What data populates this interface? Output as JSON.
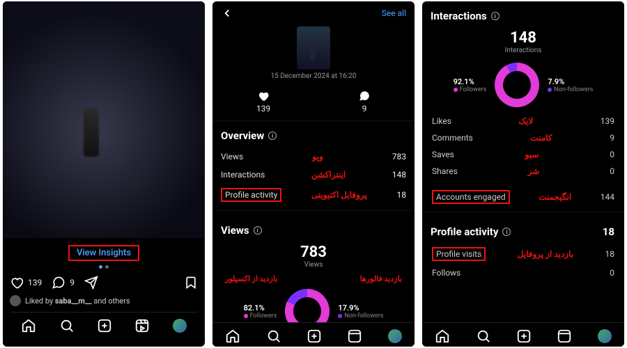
{
  "panel1": {
    "view_insights": "View Insights",
    "likes": "139",
    "comments": "9",
    "liked_by_prefix": "Liked by",
    "liked_by_user": "saba__m__",
    "liked_by_suffix": "and others"
  },
  "panel2": {
    "see_all": "See all",
    "timestamp": "15 December 2024 at 16:20",
    "likes": "139",
    "comments": "9",
    "overview_title": "Overview",
    "rows": {
      "views": {
        "label": "Views",
        "anno": "ویو",
        "value": "783"
      },
      "interactions": {
        "label": "Interactions",
        "anno": "اینتراکشن",
        "value": "148"
      },
      "profile": {
        "label": "Profile activity",
        "anno": "پروفایل اکتیویتی",
        "value": "18"
      }
    },
    "views_title": "Views",
    "views_total": "783",
    "views_sub": "Views",
    "followers_pct": "82.1%",
    "followers_lab": "Followers",
    "non_followers_pct": "17.9%",
    "non_followers_lab": "Non-followers",
    "anno_followers": "بازدید فالورها",
    "anno_explore": "بازدید از اکسپلور",
    "colors": {
      "followers": "#e23bd8",
      "nonfollowers": "#7b2fff"
    }
  },
  "panel3": {
    "interactions_title": "Interactions",
    "interactions_total": "148",
    "interactions_sub": "Interactions",
    "followers_pct": "92.1%",
    "followers_lab": "Followers",
    "non_followers_pct": "7.9%",
    "non_followers_lab": "Non-followers",
    "rows": {
      "likes": {
        "label": "Likes",
        "anno": "لایک",
        "value": "139"
      },
      "comments": {
        "label": "Comments",
        "anno": "کامنت",
        "value": "9"
      },
      "saves": {
        "label": "Saves",
        "anno": "سیو",
        "value": "0"
      },
      "shares": {
        "label": "Shares",
        "anno": "شر",
        "value": "0"
      }
    },
    "accounts_engaged_label": "Accounts engaged",
    "accounts_engaged_anno": "انگیجمنت",
    "accounts_engaged_value": "144",
    "profile_activity_title": "Profile activity",
    "profile_activity_value": "18",
    "profile_visits_label": "Profile visits",
    "profile_visits_anno": "بازدید از پروفایل",
    "profile_visits_value": "18",
    "follows_label": "Follows",
    "follows_value": "0",
    "colors": {
      "followers": "#e23bd8",
      "nonfollowers": "#7b2fff"
    }
  },
  "chart_data": [
    {
      "type": "pie",
      "title": "Views breakdown",
      "series": [
        {
          "name": "Followers",
          "value": 82.1
        },
        {
          "name": "Non-followers",
          "value": 17.9
        }
      ]
    },
    {
      "type": "pie",
      "title": "Interactions breakdown",
      "series": [
        {
          "name": "Followers",
          "value": 92.1
        },
        {
          "name": "Non-followers",
          "value": 7.9
        }
      ]
    }
  ]
}
